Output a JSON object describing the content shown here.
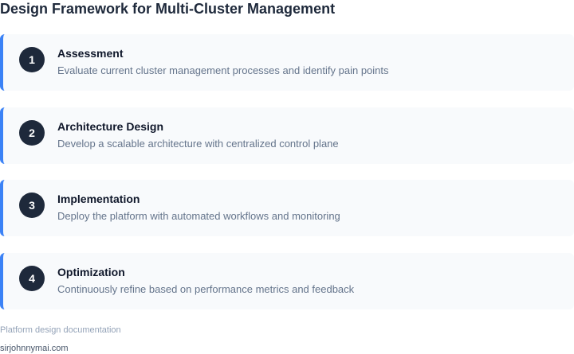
{
  "title": "Design Framework for Multi-Cluster Management",
  "colors": {
    "accent": "#3b82f6",
    "badge": "#1e293b",
    "card_background": "#f8fafc"
  },
  "steps": [
    {
      "number": "1",
      "title": "Assessment",
      "description": "Evaluate current cluster management processes and identify pain points"
    },
    {
      "number": "2",
      "title": "Architecture Design",
      "description": "Develop a scalable architecture with centralized control plane"
    },
    {
      "number": "3",
      "title": "Implementation",
      "description": "Deploy the platform with automated workflows and monitoring"
    },
    {
      "number": "4",
      "title": "Optimization",
      "description": "Continuously refine based on performance metrics and feedback"
    }
  ],
  "caption": "Platform design documentation",
  "source": "sirjohnnymai.com"
}
